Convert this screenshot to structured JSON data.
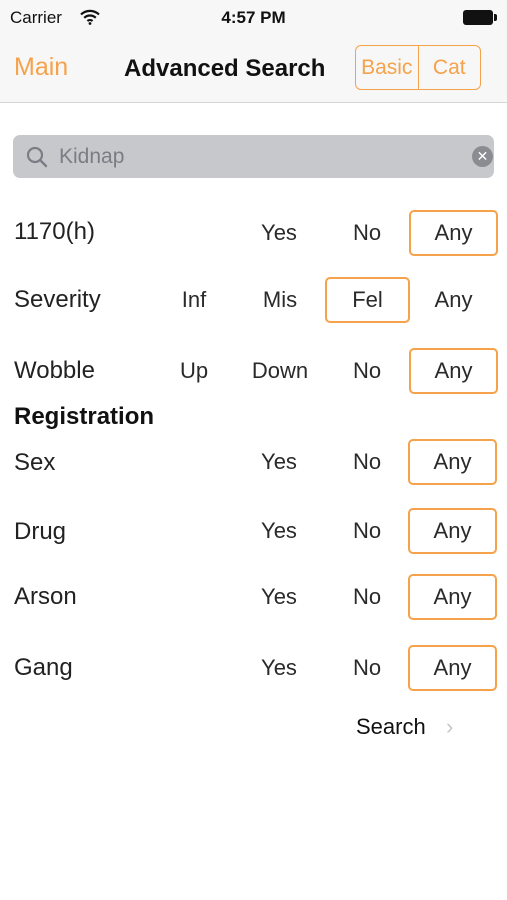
{
  "status": {
    "carrier": "Carrier",
    "time": "4:57 PM"
  },
  "nav": {
    "back_label": "Main",
    "title": "Advanced Search",
    "segments": [
      "Basic",
      "Cat"
    ]
  },
  "search": {
    "value": "Kidnap",
    "clear_icon": "clear-icon",
    "icon": "search-icon"
  },
  "filters": {
    "r1170": {
      "label": "1170(h)",
      "options": [
        "Yes",
        "No",
        "Any"
      ],
      "selected": "Any"
    },
    "severity": {
      "label": "Severity",
      "options": [
        "Inf",
        "Mis",
        "Fel",
        "Any"
      ],
      "selected": "Fel"
    },
    "wobble": {
      "label": "Wobble",
      "options": [
        "Up",
        "Down",
        "No",
        "Any"
      ],
      "selected": "Any"
    }
  },
  "registration": {
    "header": "Registration",
    "sex": {
      "label": "Sex",
      "options": [
        "Yes",
        "No",
        "Any"
      ],
      "selected": "Any"
    },
    "drug": {
      "label": "Drug",
      "options": [
        "Yes",
        "No",
        "Any"
      ],
      "selected": "Any"
    },
    "arson": {
      "label": "Arson",
      "options": [
        "Yes",
        "No",
        "Any"
      ],
      "selected": "Any"
    },
    "gang": {
      "label": "Gang",
      "options": [
        "Yes",
        "No",
        "Any"
      ],
      "selected": "Any"
    }
  },
  "action": {
    "search_label": "Search",
    "chevron": "›"
  },
  "colors": {
    "accent": "#f6a24a",
    "search_bg": "#c7c8cc",
    "bar_bg": "#f7f7f7"
  }
}
